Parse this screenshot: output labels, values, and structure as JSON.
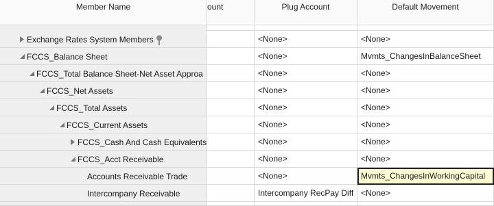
{
  "columns": {
    "member_name": "Member Name",
    "account": "count",
    "plug_account": "Plug Account",
    "default_movement": "Default Movement"
  },
  "rows": [
    {
      "member": "Exchange Rates System Members",
      "plug": "<None>",
      "movement": "<None>"
    },
    {
      "member": "FCCS_Balance Sheet",
      "plug": "<None>",
      "movement": "Mvmts_ChangesInBalanceSheet"
    },
    {
      "member": "FCCS_Total Balance Sheet-Net Asset Approa",
      "plug": "<None>",
      "movement": "<None>"
    },
    {
      "member": "FCCS_Net Assets",
      "plug": "<None>",
      "movement": "<None>"
    },
    {
      "member": "FCCS_Total Assets",
      "plug": "<None>",
      "movement": "<None>"
    },
    {
      "member": "FCCS_Current Assets",
      "plug": "<None>",
      "movement": "<None>"
    },
    {
      "member": "FCCS_Cash And Cash Equivalents",
      "plug": "<None>",
      "movement": "<None>"
    },
    {
      "member": "FCCS_Acct Receivable",
      "plug": "<None>",
      "movement": "<None>"
    },
    {
      "member": "Accounts Receivable Trade",
      "plug": "<None>",
      "movement": "Mvmts_ChangesInWorkingCapital"
    },
    {
      "member": "Intercompany Receivable",
      "plug": "Intercompany RecPay Diff",
      "movement": "<None>"
    }
  ],
  "icons": {
    "expanded": "triangle-down-icon",
    "collapsed": "triangle-right-icon",
    "pin": "pin-icon"
  }
}
